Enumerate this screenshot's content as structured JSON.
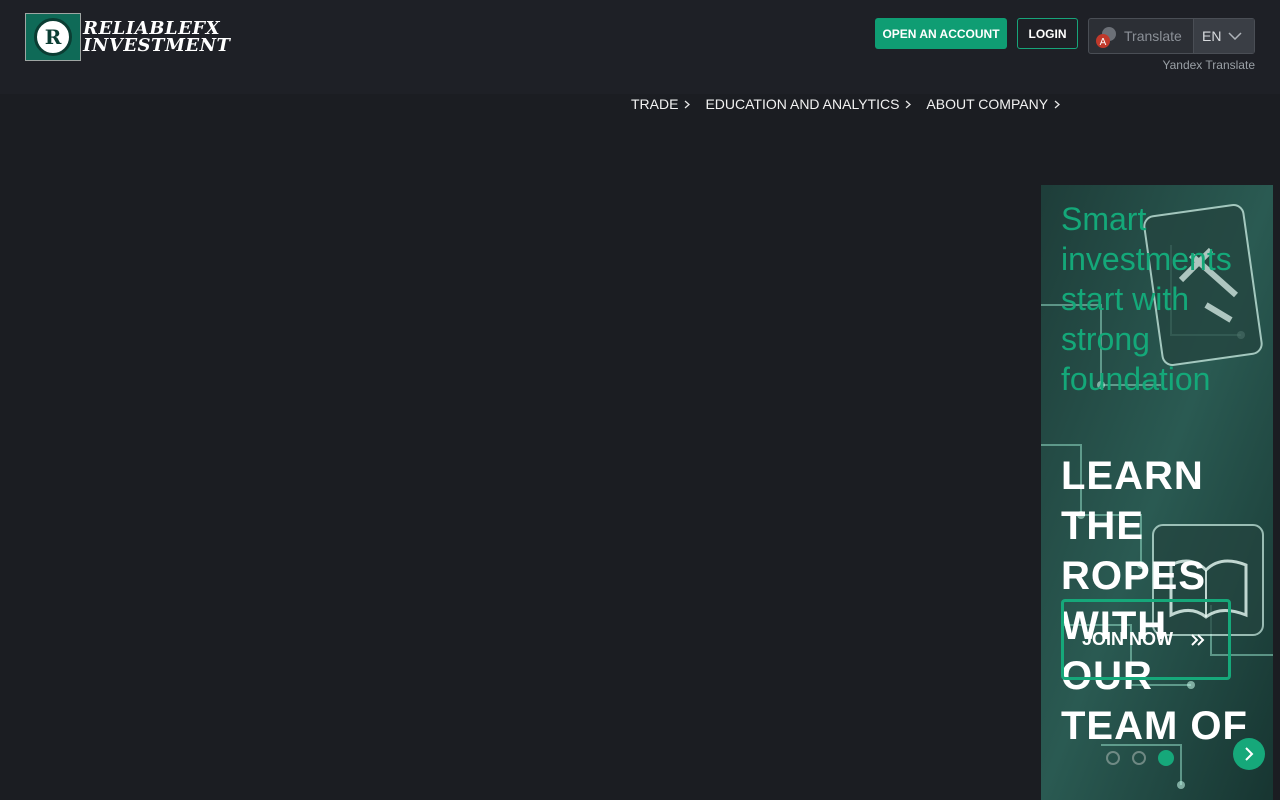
{
  "header": {
    "logo": {
      "mark_letter": "R",
      "line1": "RELIABLEFX",
      "line2": "INVESTMENT"
    },
    "open_account_label": "OPEN AN ACCOUNT",
    "login_label": "LOGIN",
    "translate": {
      "label": "Translate",
      "language": "EN",
      "provider": "Yandex Translate"
    }
  },
  "nav": {
    "items": [
      {
        "label": "TRADE"
      },
      {
        "label": "EDUCATION AND ANALYTICS"
      },
      {
        "label": "ABOUT COMPANY"
      }
    ]
  },
  "hero": {
    "subtitle": "Smart investments start with strong foundation",
    "title": "LEARN THE ROPES WITH OUR TEAM OF",
    "cta_label": "JOIN NOW",
    "slides_total": 3,
    "active_slide": 3
  },
  "colors": {
    "background": "#1b1d22",
    "accent": "#0f9d73",
    "hero_green": "#14a879"
  },
  "icons": [
    "logo-emblem-icon",
    "translate-icon",
    "chevron-right-icon",
    "chevron-down-icon",
    "double-chevron-right-icon",
    "arrow-right-icon"
  ]
}
